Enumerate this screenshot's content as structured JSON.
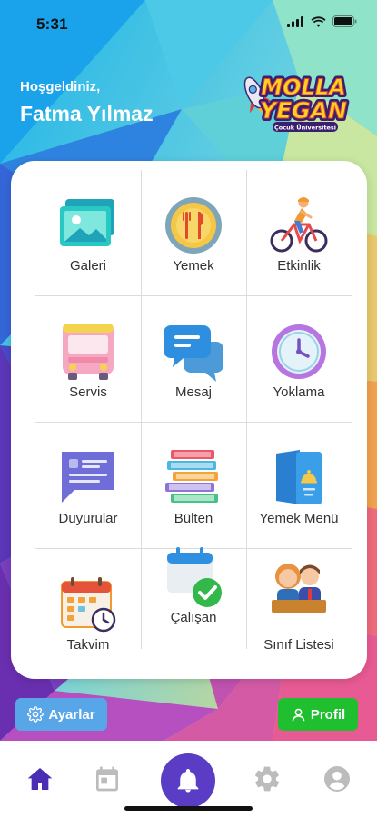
{
  "status_bar": {
    "time": "5:31"
  },
  "header": {
    "welcome": "Hoşgeldiniz,",
    "user_name": "Fatma Yılmaz"
  },
  "logo": {
    "line1": "MOLLA",
    "line2": "YEGAN",
    "tagline": "Çocuk Üniversitesi"
  },
  "menu": [
    {
      "label": "Galeri",
      "icon": "gallery-icon"
    },
    {
      "label": "Yemek",
      "icon": "meal-icon"
    },
    {
      "label": "Etkinlik",
      "icon": "activity-icon"
    },
    {
      "label": "Servis",
      "icon": "bus-icon"
    },
    {
      "label": "Mesaj",
      "icon": "message-icon"
    },
    {
      "label": "Yoklama",
      "icon": "clock-icon"
    },
    {
      "label": "Duyurular",
      "icon": "announcement-icon"
    },
    {
      "label": "Bülten",
      "icon": "books-icon"
    },
    {
      "label": "Yemek Menü",
      "icon": "food-menu-icon"
    },
    {
      "label": "Takvim",
      "icon": "calendar-icon"
    },
    {
      "label": "Çalışan",
      "icon": "staff-calendar-check-icon"
    },
    {
      "label": "Sınıf Listesi",
      "icon": "class-list-icon"
    }
  ],
  "buttons": {
    "settings": "Ayarlar",
    "profile": "Profil"
  },
  "tabbar": [
    "home-icon",
    "calendar-icon",
    "bell-icon",
    "gear-icon",
    "user-icon"
  ],
  "colors": {
    "accent": "#5b3cc4",
    "settings_button": "#58a6e8",
    "profile_button": "#1fbf2f"
  }
}
